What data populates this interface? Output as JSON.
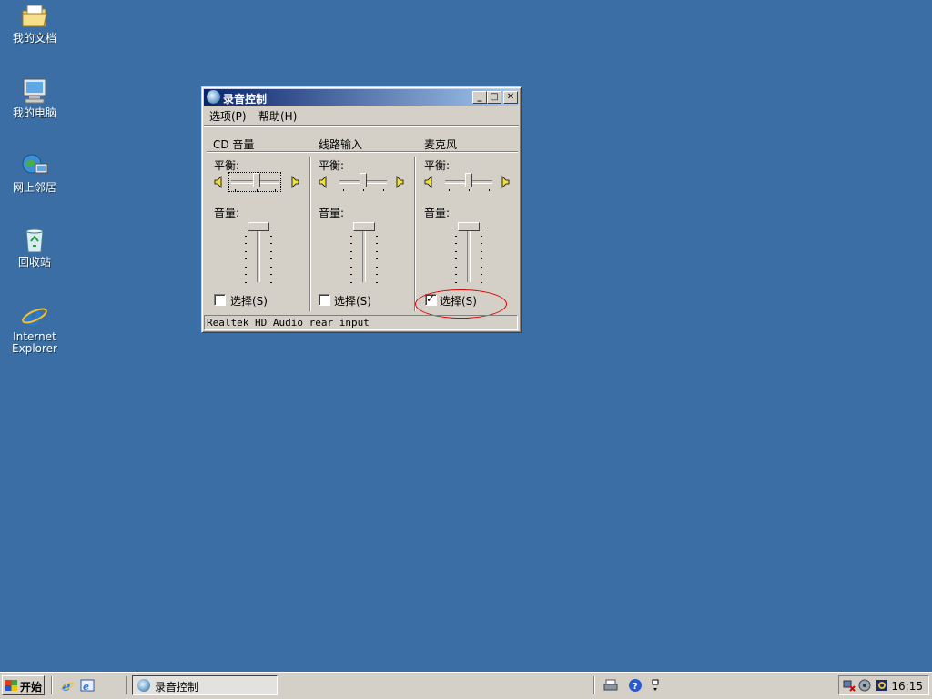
{
  "desktop": {
    "icons": [
      {
        "label": "我的文档",
        "icon": "my-documents-icon"
      },
      {
        "label": "我的电脑",
        "icon": "my-computer-icon"
      },
      {
        "label": "网上邻居",
        "icon": "network-places-icon"
      },
      {
        "label": "回收站",
        "icon": "recycle-bin-icon"
      },
      {
        "label": "Internet\nExplorer",
        "icon": "internet-explorer-icon"
      }
    ]
  },
  "window": {
    "title": "录音控制",
    "menu": [
      "选项(P)",
      "帮助(H)"
    ],
    "columns": [
      {
        "title": "CD 音量",
        "balance_label": "平衡:",
        "volume_label": "音量:",
        "select_label": "选择(S)",
        "selected": false
      },
      {
        "title": "线路输入",
        "balance_label": "平衡:",
        "volume_label": "音量:",
        "select_label": "选择(S)",
        "selected": false
      },
      {
        "title": "麦克风",
        "balance_label": "平衡:",
        "volume_label": "音量:",
        "select_label": "选择(S)",
        "selected": true
      }
    ],
    "status": "Realtek HD Audio rear input"
  },
  "taskbar": {
    "start_label": "开始",
    "task_label": "录音控制",
    "clock": "16:15"
  },
  "colors": {
    "desktop": "#3a6ea5",
    "title_start": "#0a246a",
    "title_end": "#a6caf0",
    "highlight_ellipse": "#e00000"
  }
}
